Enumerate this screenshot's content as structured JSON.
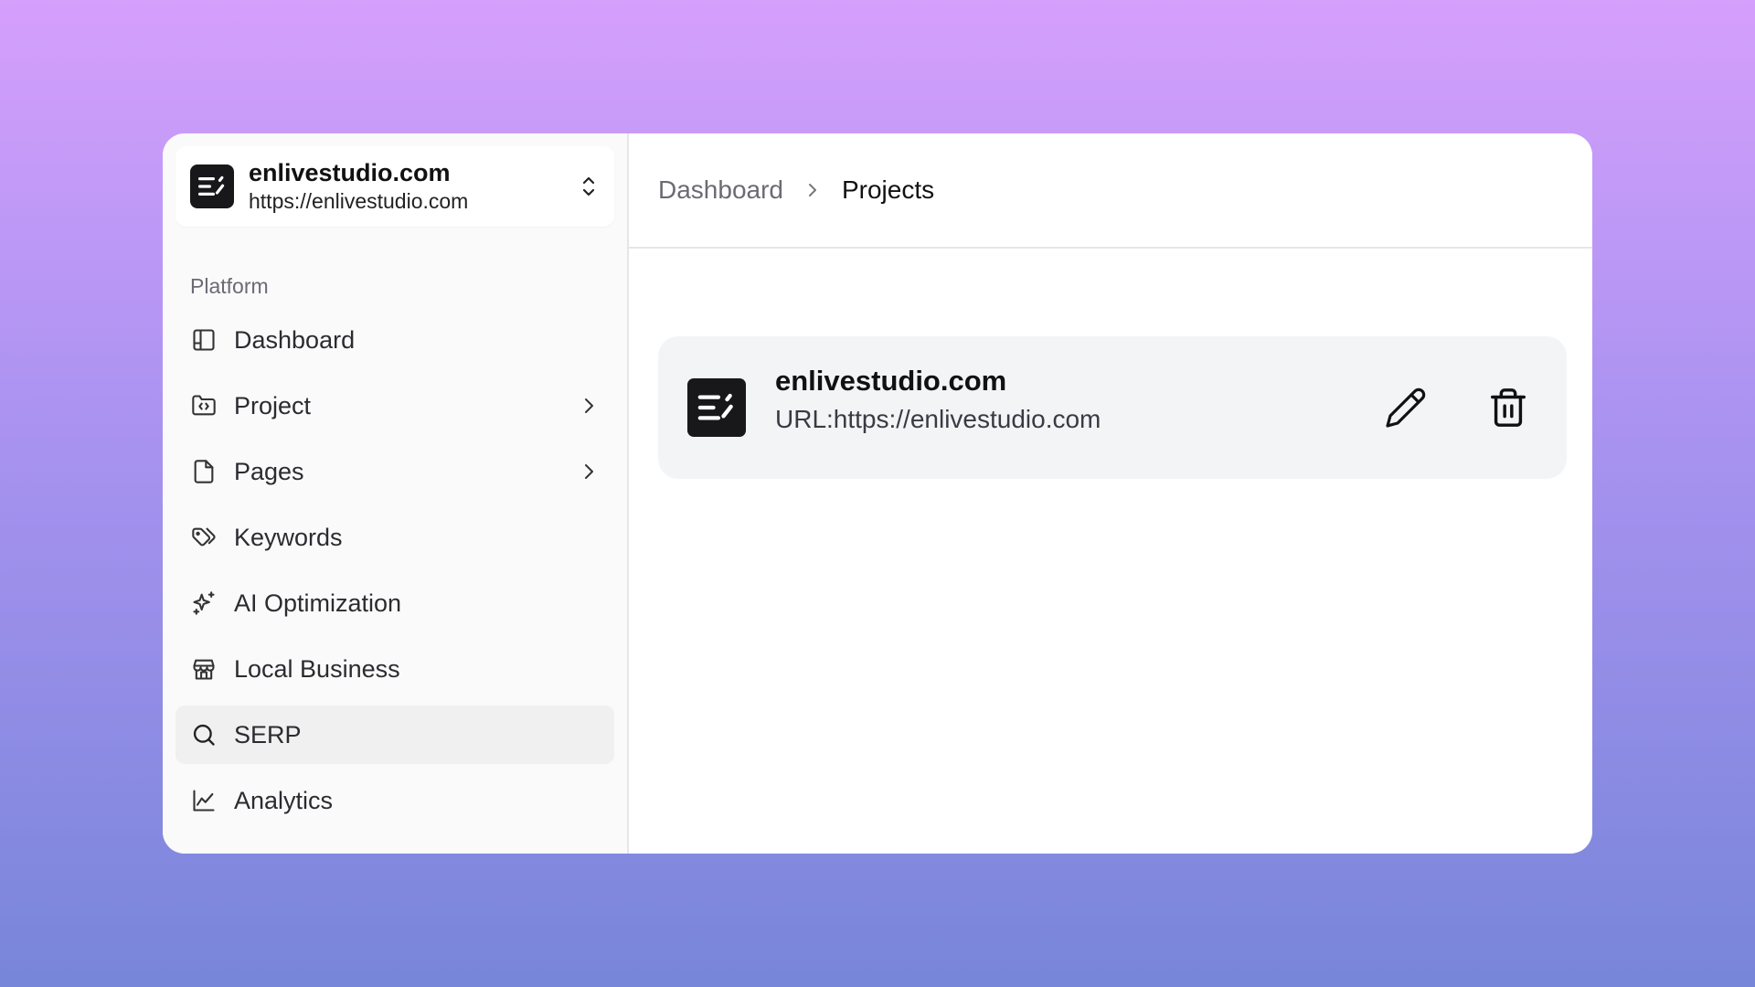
{
  "workspace": {
    "name": "enlivestudio.com",
    "url": "https://enlivestudio.com"
  },
  "sidebar": {
    "group_label": "Platform",
    "items": [
      {
        "label": "Dashboard",
        "icon": "layout-panel-icon"
      },
      {
        "label": "Project",
        "icon": "folder-code-icon",
        "has_submenu": true
      },
      {
        "label": "Pages",
        "icon": "file-icon",
        "has_submenu": true
      },
      {
        "label": "Keywords",
        "icon": "tags-icon"
      },
      {
        "label": "AI Optimization",
        "icon": "sparkles-icon"
      },
      {
        "label": "Local Business",
        "icon": "store-icon"
      },
      {
        "label": "SERP",
        "icon": "search-icon",
        "active": true
      },
      {
        "label": "Analytics",
        "icon": "line-chart-icon"
      }
    ]
  },
  "breadcrumb": {
    "parent": "Dashboard",
    "current": "Projects"
  },
  "projects": [
    {
      "name": "enlivestudio.com",
      "url_text": "URL:https://enlivestudio.com"
    }
  ],
  "colors": {
    "logo_bg": "#18181b",
    "active_item_bg": "#f0f0f1",
    "card_bg": "#f3f4f6"
  }
}
